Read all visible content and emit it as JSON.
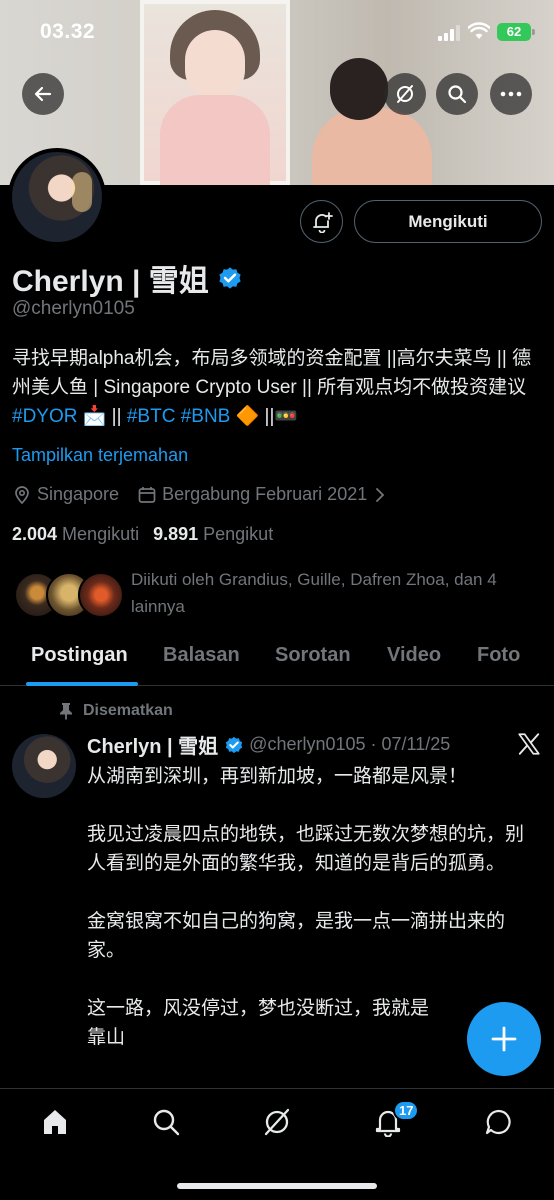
{
  "status_bar": {
    "time": "03.32",
    "battery": "62"
  },
  "profile": {
    "name": "Cherlyn | 雪姐",
    "handle": "@cherlyn0105",
    "follow_button": "Mengikuti",
    "bio_part1": "寻找早期alpha机会，布局多领域的资金配置 ||高尔夫菜鸟 || 德州美人鱼 | Singapore Crypto User || 所有观点均不做投资建议 ",
    "bio_tag1": "#DYOR",
    "bio_part2": " 📩 || ",
    "bio_tag2": "#BTC",
    "bio_space": " ",
    "bio_tag3": "#BNB",
    "bio_part3": " 🔶 ||🚥",
    "translate_link": "Tampilkan terjemahan",
    "location": "Singapore",
    "joined": "Bergabung Februari 2021",
    "following_count": "2.004",
    "following_label": "Mengikuti",
    "followers_count": "9.891",
    "followers_label": "Pengikut",
    "followed_by": "Diikuti oleh Grandius, Guille, Dafren Zhoa, dan 4 lainnya"
  },
  "tabs": [
    "Postingan",
    "Balasan",
    "Sorotan",
    "Video",
    "Foto"
  ],
  "pinned_post": {
    "pinned_label": "Disematkan",
    "author": "Cherlyn | 雪姐",
    "meta": "@cherlyn0105 · 07/11/25",
    "text": "从湖南到深圳，再到新加坡，一路都是风景！\n\n我见过凌晨四点的地铁，也踩过无数次梦想的坑，别人看到的是外面的繁华我，知道的是背后的孤勇。\n\n金窝银窝不如自己的狗窝，是我一点一滴拼出来的家。\n\n这一路，风没停过，梦也没断过，我就是\n靠山"
  },
  "bottom_nav": {
    "notification_count": "17"
  },
  "colors": {
    "accent": "#1d9bf0",
    "background": "#000000",
    "muted": "#71767b",
    "battery": "#34c759"
  }
}
